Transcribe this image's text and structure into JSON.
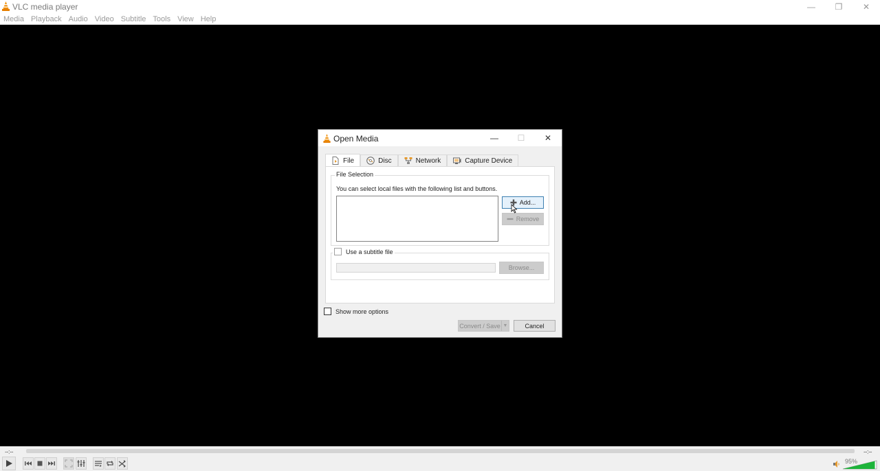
{
  "window": {
    "title": "VLC media player",
    "controls": {
      "minimize": "—",
      "maximize": "❐",
      "close": "✕"
    }
  },
  "menubar": {
    "items": [
      "Media",
      "Playback",
      "Audio",
      "Video",
      "Subtitle",
      "Tools",
      "View",
      "Help"
    ]
  },
  "player": {
    "time_elapsed": "--:--",
    "time_total": "--:--",
    "seek_progress": 0,
    "volume_label": "95%",
    "volume_level": 0.95,
    "accent_color": "#1db43a",
    "buttons": [
      "play",
      "previous",
      "stop",
      "next",
      "fullscreen",
      "extended-settings",
      "playlist",
      "loop",
      "shuffle"
    ]
  },
  "dialog": {
    "title": "Open Media",
    "controls": {
      "minimize": "—",
      "maximize": "☐",
      "close": "✕"
    },
    "tabs": [
      {
        "label": "File",
        "icon": "file-icon",
        "active": true
      },
      {
        "label": "Disc",
        "icon": "disc-icon",
        "active": false
      },
      {
        "label": "Network",
        "icon": "network-icon",
        "active": false
      },
      {
        "label": "Capture Device",
        "icon": "capture-device-icon",
        "active": false
      }
    ],
    "file_selection": {
      "group_label": "File Selection",
      "description": "You can select local files with the following list and buttons.",
      "files": [],
      "add_label": "Add...",
      "remove_label": "Remove"
    },
    "subtitle": {
      "checkbox_label": "Use a subtitle file",
      "checked": false,
      "path_value": "",
      "browse_label": "Browse..."
    },
    "show_more_options": {
      "label": "Show more options",
      "checked": false
    },
    "convert_save_label": "Convert / Save",
    "cancel_label": "Cancel"
  }
}
